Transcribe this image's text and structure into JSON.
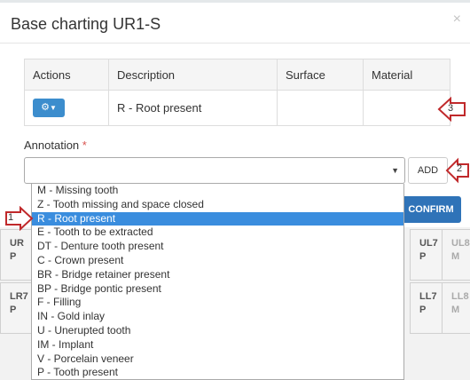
{
  "modal": {
    "title": "Base charting UR1-S",
    "close_glyph": "×"
  },
  "table": {
    "headers": [
      "Actions",
      "Description",
      "Surface",
      "Material"
    ],
    "row": {
      "action_icon": "gear-icon",
      "caret_icon": "caret-down-icon",
      "description": "R - Root present",
      "surface": "",
      "material": ""
    }
  },
  "annotation": {
    "label": "Annotation",
    "required_mark": "*",
    "value": ""
  },
  "buttons": {
    "add": "ADD",
    "confirm": "CONFIRM"
  },
  "dropdown": {
    "options": [
      "M - Missing tooth",
      "Z - Tooth missing and space closed",
      "R - Root present",
      "E - Tooth to be extracted",
      "DT - Denture tooth present",
      "C - Crown present",
      "BR - Bridge retainer present",
      "BP - Bridge pontic present",
      "F - Filling",
      "IN - Gold inlay",
      "U - Unerupted tooth",
      "IM - Implant",
      "V - Porcelain veneer",
      "P - Tooth present"
    ],
    "selected": "R - Root present"
  },
  "teeth": [
    {
      "code": "UR",
      "status": "P"
    },
    {
      "code": "LR7",
      "status": "P"
    },
    {
      "code": "UL7",
      "status": "P"
    },
    {
      "code": "UL8",
      "status": "M"
    },
    {
      "code": "LL7",
      "status": "P"
    },
    {
      "code": "LL8",
      "status": "M"
    }
  ],
  "callouts": [
    "1",
    "2",
    "3"
  ],
  "colors": {
    "primary": "#2f73b8",
    "selected": "#3a8dde",
    "callout": "#c0292b"
  }
}
